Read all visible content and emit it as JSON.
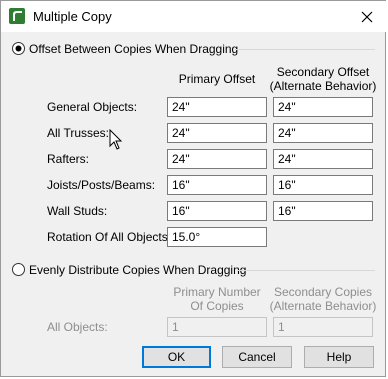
{
  "window": {
    "title": "Multiple Copy",
    "close_icon": "close-icon",
    "app_icon": "chief-architect-icon"
  },
  "option_offset": {
    "label": "Offset Between Copies When Dragging",
    "selected": true
  },
  "offset_columns": {
    "primary": "Primary Offset",
    "secondary_line1": "Secondary Offset",
    "secondary_line2": "(Alternate Behavior)"
  },
  "offset_rows": [
    {
      "label": "General Objects:",
      "primary": "24\"",
      "secondary": "24\""
    },
    {
      "label": "All Trusses:",
      "primary": "24\"",
      "secondary": "24\""
    },
    {
      "label": "Rafters:",
      "primary": "24\"",
      "secondary": "24\""
    },
    {
      "label": "Joists/Posts/Beams:",
      "primary": "16\"",
      "secondary": "16\""
    },
    {
      "label": "Wall Studs:",
      "primary": "16\"",
      "secondary": "16\""
    }
  ],
  "rotation": {
    "label": "Rotation Of All Objects:",
    "value": "15.0°"
  },
  "option_distribute": {
    "label": "Evenly Distribute Copies When Dragging",
    "selected": false
  },
  "distribute_columns": {
    "primary_line1": "Primary Number",
    "primary_line2": "Of Copies",
    "secondary_line1": "Secondary Copies",
    "secondary_line2": "(Alternate Behavior)"
  },
  "distribute_row": {
    "label": "All Objects:",
    "primary": "1",
    "secondary": "1"
  },
  "buttons": {
    "ok": "OK",
    "cancel": "Cancel",
    "help": "Help"
  },
  "colors": {
    "accent": "#0078d7",
    "disabled_text": "#8e8e8e",
    "dialog_bg": "#f0f0f0"
  }
}
